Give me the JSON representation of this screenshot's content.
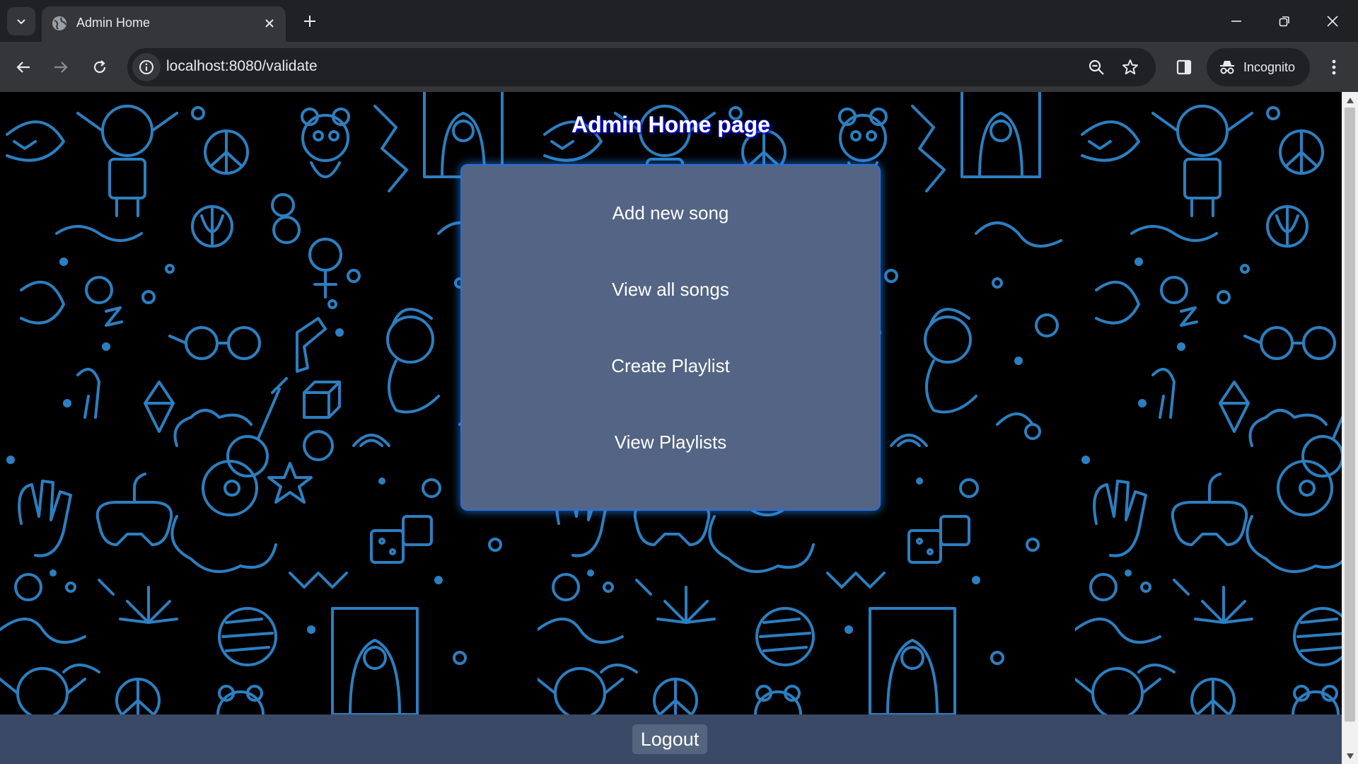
{
  "browser": {
    "tab_title": "Admin Home",
    "url": "localhost:8080/validate",
    "incognito_label": "Incognito"
  },
  "page": {
    "title": "Admin Home page",
    "menu": [
      {
        "label": "Add new song"
      },
      {
        "label": "View all songs"
      },
      {
        "label": "Create Playlist"
      },
      {
        "label": "View Playlists"
      }
    ],
    "logout_label": "Logout"
  },
  "colors": {
    "pattern_stroke": "#2c7fc0",
    "card_bg": "#536484",
    "footer_bg": "#3a4a66"
  }
}
